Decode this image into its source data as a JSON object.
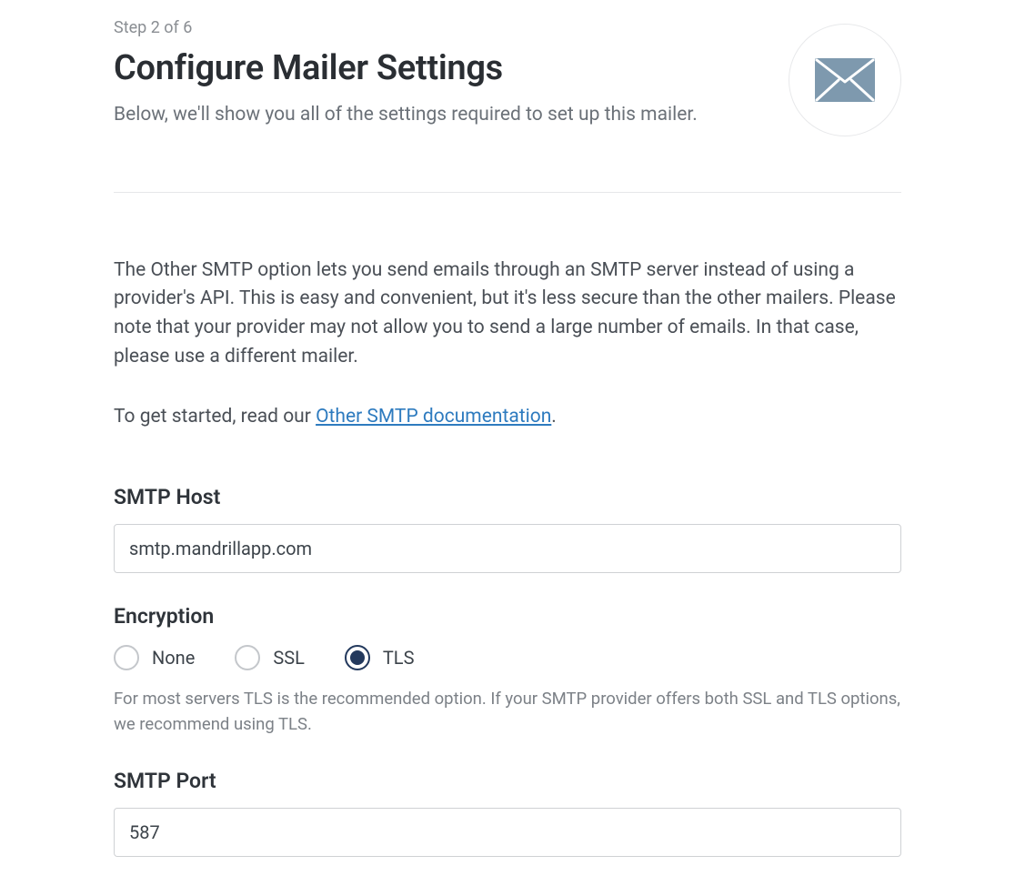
{
  "header": {
    "step_indicator": "Step 2 of 6",
    "title": "Configure Mailer Settings",
    "subtitle": "Below, we'll show you all of the settings required to set up this mailer."
  },
  "body": {
    "info_text": "The Other SMTP option lets you send emails through an SMTP server instead of using a provider's API. This is easy and convenient, but it's less secure than the other mailers. Please note that your provider may not allow you to send a large number of emails. In that case, please use a different mailer.",
    "doc_intro": "To get started, read our ",
    "doc_link_text": "Other SMTP documentation",
    "doc_suffix": "."
  },
  "fields": {
    "smtp_host": {
      "label": "SMTP Host",
      "value": "smtp.mandrillapp.com"
    },
    "encryption": {
      "label": "Encryption",
      "options": {
        "none": "None",
        "ssl": "SSL",
        "tls": "TLS"
      },
      "selected": "tls",
      "help": "For most servers TLS is the recommended option. If your SMTP provider offers both SSL and TLS options, we recommend using TLS."
    },
    "smtp_port": {
      "label": "SMTP Port",
      "value": "587"
    }
  }
}
